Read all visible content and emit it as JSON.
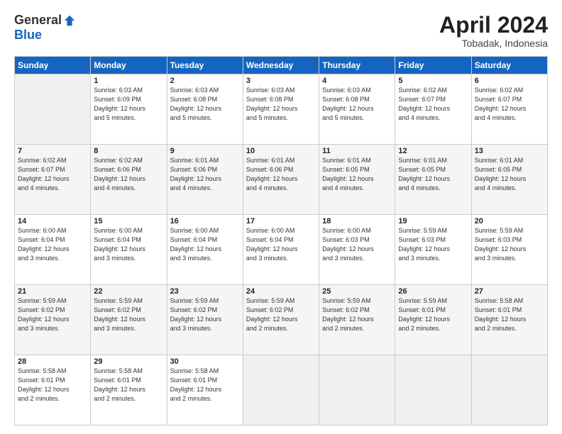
{
  "header": {
    "logo_general": "General",
    "logo_blue": "Blue",
    "month_title": "April 2024",
    "subtitle": "Tobadak, Indonesia"
  },
  "days_of_week": [
    "Sunday",
    "Monday",
    "Tuesday",
    "Wednesday",
    "Thursday",
    "Friday",
    "Saturday"
  ],
  "weeks": [
    [
      {
        "day": "",
        "info": ""
      },
      {
        "day": "1",
        "info": "Sunrise: 6:03 AM\nSunset: 6:09 PM\nDaylight: 12 hours\nand 5 minutes."
      },
      {
        "day": "2",
        "info": "Sunrise: 6:03 AM\nSunset: 6:08 PM\nDaylight: 12 hours\nand 5 minutes."
      },
      {
        "day": "3",
        "info": "Sunrise: 6:03 AM\nSunset: 6:08 PM\nDaylight: 12 hours\nand 5 minutes."
      },
      {
        "day": "4",
        "info": "Sunrise: 6:03 AM\nSunset: 6:08 PM\nDaylight: 12 hours\nand 5 minutes."
      },
      {
        "day": "5",
        "info": "Sunrise: 6:02 AM\nSunset: 6:07 PM\nDaylight: 12 hours\nand 4 minutes."
      },
      {
        "day": "6",
        "info": "Sunrise: 6:02 AM\nSunset: 6:07 PM\nDaylight: 12 hours\nand 4 minutes."
      }
    ],
    [
      {
        "day": "7",
        "info": "Sunrise: 6:02 AM\nSunset: 6:07 PM\nDaylight: 12 hours\nand 4 minutes."
      },
      {
        "day": "8",
        "info": "Sunrise: 6:02 AM\nSunset: 6:06 PM\nDaylight: 12 hours\nand 4 minutes."
      },
      {
        "day": "9",
        "info": "Sunrise: 6:01 AM\nSunset: 6:06 PM\nDaylight: 12 hours\nand 4 minutes."
      },
      {
        "day": "10",
        "info": "Sunrise: 6:01 AM\nSunset: 6:06 PM\nDaylight: 12 hours\nand 4 minutes."
      },
      {
        "day": "11",
        "info": "Sunrise: 6:01 AM\nSunset: 6:05 PM\nDaylight: 12 hours\nand 4 minutes."
      },
      {
        "day": "12",
        "info": "Sunrise: 6:01 AM\nSunset: 6:05 PM\nDaylight: 12 hours\nand 4 minutes."
      },
      {
        "day": "13",
        "info": "Sunrise: 6:01 AM\nSunset: 6:05 PM\nDaylight: 12 hours\nand 4 minutes."
      }
    ],
    [
      {
        "day": "14",
        "info": "Sunrise: 6:00 AM\nSunset: 6:04 PM\nDaylight: 12 hours\nand 3 minutes."
      },
      {
        "day": "15",
        "info": "Sunrise: 6:00 AM\nSunset: 6:04 PM\nDaylight: 12 hours\nand 3 minutes."
      },
      {
        "day": "16",
        "info": "Sunrise: 6:00 AM\nSunset: 6:04 PM\nDaylight: 12 hours\nand 3 minutes."
      },
      {
        "day": "17",
        "info": "Sunrise: 6:00 AM\nSunset: 6:04 PM\nDaylight: 12 hours\nand 3 minutes."
      },
      {
        "day": "18",
        "info": "Sunrise: 6:00 AM\nSunset: 6:03 PM\nDaylight: 12 hours\nand 3 minutes."
      },
      {
        "day": "19",
        "info": "Sunrise: 5:59 AM\nSunset: 6:03 PM\nDaylight: 12 hours\nand 3 minutes."
      },
      {
        "day": "20",
        "info": "Sunrise: 5:59 AM\nSunset: 6:03 PM\nDaylight: 12 hours\nand 3 minutes."
      }
    ],
    [
      {
        "day": "21",
        "info": "Sunrise: 5:59 AM\nSunset: 6:02 PM\nDaylight: 12 hours\nand 3 minutes."
      },
      {
        "day": "22",
        "info": "Sunrise: 5:59 AM\nSunset: 6:02 PM\nDaylight: 12 hours\nand 3 minutes."
      },
      {
        "day": "23",
        "info": "Sunrise: 5:59 AM\nSunset: 6:02 PM\nDaylight: 12 hours\nand 3 minutes."
      },
      {
        "day": "24",
        "info": "Sunrise: 5:59 AM\nSunset: 6:02 PM\nDaylight: 12 hours\nand 2 minutes."
      },
      {
        "day": "25",
        "info": "Sunrise: 5:59 AM\nSunset: 6:02 PM\nDaylight: 12 hours\nand 2 minutes."
      },
      {
        "day": "26",
        "info": "Sunrise: 5:59 AM\nSunset: 6:01 PM\nDaylight: 12 hours\nand 2 minutes."
      },
      {
        "day": "27",
        "info": "Sunrise: 5:58 AM\nSunset: 6:01 PM\nDaylight: 12 hours\nand 2 minutes."
      }
    ],
    [
      {
        "day": "28",
        "info": "Sunrise: 5:58 AM\nSunset: 6:01 PM\nDaylight: 12 hours\nand 2 minutes."
      },
      {
        "day": "29",
        "info": "Sunrise: 5:58 AM\nSunset: 6:01 PM\nDaylight: 12 hours\nand 2 minutes."
      },
      {
        "day": "30",
        "info": "Sunrise: 5:58 AM\nSunset: 6:01 PM\nDaylight: 12 hours\nand 2 minutes."
      },
      {
        "day": "",
        "info": ""
      },
      {
        "day": "",
        "info": ""
      },
      {
        "day": "",
        "info": ""
      },
      {
        "day": "",
        "info": ""
      }
    ]
  ]
}
